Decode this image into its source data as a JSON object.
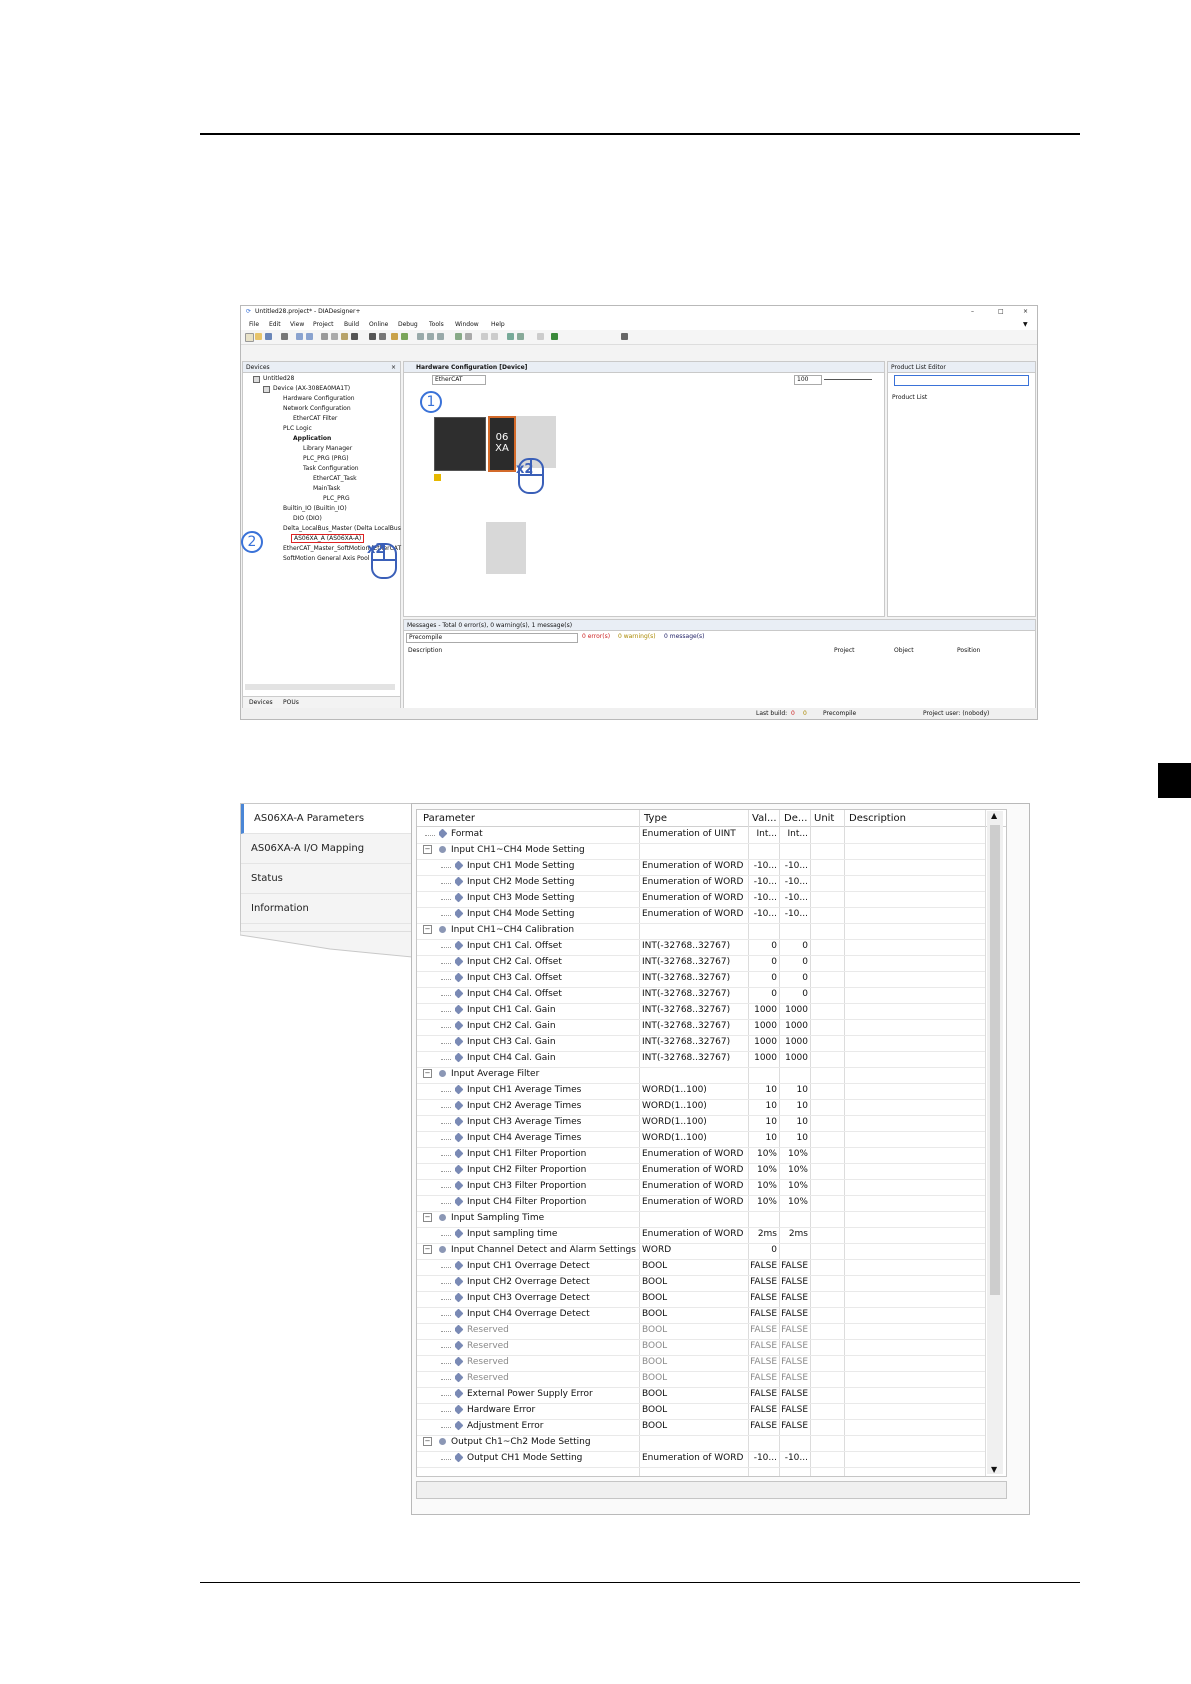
{
  "shot1": {
    "title": "Untitled28.project* - DIADesigner+",
    "window_controls": [
      "–",
      "□",
      "×"
    ],
    "menu": [
      "File",
      "Edit",
      "View",
      "Project",
      "Build",
      "Online",
      "Debug",
      "Tools",
      "Window",
      "Help"
    ],
    "devices_panel": {
      "title": "Devices",
      "tree": [
        "Untitled28",
        "Device (AX-308EA0MA1T)",
        "Hardware Configuration",
        "Network Configuration",
        "EtherCAT Filter",
        "PLC Logic",
        "Application",
        "Library Manager",
        "PLC_PRG (PRG)",
        "Task Configuration",
        "EtherCAT_Task",
        "MainTask",
        "PLC_PRG",
        "Builtin_IO (Builtin_IO)",
        "DIO (DIO)",
        "Delta_LocalBus_Master (Delta LocalBus Master)",
        "AS06XA_A (AS06XA-A)",
        "EtherCAT_Master_SoftMotion (EtherCAT Master S",
        "SoftMotion General Axis Pool"
      ],
      "bottom_tabs": [
        "Devices",
        "POUs"
      ]
    },
    "hw_tab": "Hardware Configuration [Device]",
    "network_select": "EtherCAT",
    "zoom": "100",
    "module_label_top": "06",
    "module_label_bottom": "XA",
    "product_panel": {
      "title": "Product List Editor",
      "tab": "Product List"
    },
    "messages": {
      "title": "Messages - Total 0 error(s), 0 warning(s), 1 message(s)",
      "filter": "Precompile",
      "errors": "0 error(s)",
      "warnings": "0 warning(s)",
      "messages": "0 message(s)",
      "cols": [
        "Description",
        "Project",
        "Object",
        "Position"
      ]
    },
    "status": {
      "last_build": "Last build:",
      "errs": "0",
      "warns": "0",
      "precompile": "Precompile",
      "user": "Project user: (nobody)"
    },
    "step1": "1",
    "step2": "2",
    "x2a": "x2",
    "x2b": "x2"
  },
  "shot2": {
    "nav": [
      "AS06XA-A Parameters",
      "AS06XA-A I/O Mapping",
      "Status",
      "Information"
    ],
    "headers": [
      "Parameter",
      "Type",
      "Val...",
      "De...",
      "Unit",
      "Description"
    ],
    "rows": [
      {
        "lvl": 1,
        "kind": "leaf",
        "name": "Format",
        "type": "Enumeration of UINT",
        "val": "Int...",
        "def": "Int..."
      },
      {
        "lvl": 0,
        "kind": "group",
        "name": "Input CH1~CH4 Mode Setting",
        "type": "",
        "val": "",
        "def": ""
      },
      {
        "lvl": 2,
        "kind": "leaf",
        "name": "Input CH1 Mode Setting",
        "type": "Enumeration of WORD",
        "val": "-10...",
        "def": "-10..."
      },
      {
        "lvl": 2,
        "kind": "leaf",
        "name": "Input CH2 Mode Setting",
        "type": "Enumeration of WORD",
        "val": "-10...",
        "def": "-10..."
      },
      {
        "lvl": 2,
        "kind": "leaf",
        "name": "Input CH3 Mode Setting",
        "type": "Enumeration of WORD",
        "val": "-10...",
        "def": "-10..."
      },
      {
        "lvl": 2,
        "kind": "leaf",
        "name": "Input CH4 Mode Setting",
        "type": "Enumeration of WORD",
        "val": "-10...",
        "def": "-10..."
      },
      {
        "lvl": 0,
        "kind": "group",
        "name": "Input CH1~CH4 Calibration",
        "type": "",
        "val": "",
        "def": ""
      },
      {
        "lvl": 2,
        "kind": "leaf",
        "name": "Input CH1 Cal. Offset",
        "type": "INT(-32768..32767)",
        "val": "0",
        "def": "0"
      },
      {
        "lvl": 2,
        "kind": "leaf",
        "name": "Input CH2 Cal. Offset",
        "type": "INT(-32768..32767)",
        "val": "0",
        "def": "0"
      },
      {
        "lvl": 2,
        "kind": "leaf",
        "name": "Input CH3 Cal. Offset",
        "type": "INT(-32768..32767)",
        "val": "0",
        "def": "0"
      },
      {
        "lvl": 2,
        "kind": "leaf",
        "name": "Input CH4 Cal. Offset",
        "type": "INT(-32768..32767)",
        "val": "0",
        "def": "0"
      },
      {
        "lvl": 2,
        "kind": "leaf",
        "name": "Input CH1 Cal. Gain",
        "type": "INT(-32768..32767)",
        "val": "1000",
        "def": "1000"
      },
      {
        "lvl": 2,
        "kind": "leaf",
        "name": "Input CH2 Cal. Gain",
        "type": "INT(-32768..32767)",
        "val": "1000",
        "def": "1000"
      },
      {
        "lvl": 2,
        "kind": "leaf",
        "name": "Input CH3 Cal. Gain",
        "type": "INT(-32768..32767)",
        "val": "1000",
        "def": "1000"
      },
      {
        "lvl": 2,
        "kind": "leaf",
        "name": "Input CH4 Cal. Gain",
        "type": "INT(-32768..32767)",
        "val": "1000",
        "def": "1000"
      },
      {
        "lvl": 0,
        "kind": "group",
        "name": "Input Average Filter",
        "type": "",
        "val": "",
        "def": ""
      },
      {
        "lvl": 2,
        "kind": "leaf",
        "name": "Input CH1 Average Times",
        "type": "WORD(1..100)",
        "val": "10",
        "def": "10"
      },
      {
        "lvl": 2,
        "kind": "leaf",
        "name": "Input CH2 Average Times",
        "type": "WORD(1..100)",
        "val": "10",
        "def": "10"
      },
      {
        "lvl": 2,
        "kind": "leaf",
        "name": "Input CH3 Average Times",
        "type": "WORD(1..100)",
        "val": "10",
        "def": "10"
      },
      {
        "lvl": 2,
        "kind": "leaf",
        "name": "Input CH4 Average Times",
        "type": "WORD(1..100)",
        "val": "10",
        "def": "10"
      },
      {
        "lvl": 2,
        "kind": "leaf",
        "name": "Input CH1 Filter Proportion",
        "type": "Enumeration of WORD",
        "val": "10%",
        "def": "10%"
      },
      {
        "lvl": 2,
        "kind": "leaf",
        "name": "Input CH2 Filter Proportion",
        "type": "Enumeration of WORD",
        "val": "10%",
        "def": "10%"
      },
      {
        "lvl": 2,
        "kind": "leaf",
        "name": "Input CH3 Filter Proportion",
        "type": "Enumeration of WORD",
        "val": "10%",
        "def": "10%"
      },
      {
        "lvl": 2,
        "kind": "leaf",
        "name": "Input CH4 Filter Proportion",
        "type": "Enumeration of WORD",
        "val": "10%",
        "def": "10%"
      },
      {
        "lvl": 0,
        "kind": "group",
        "name": "Input Sampling Time",
        "type": "",
        "val": "",
        "def": ""
      },
      {
        "lvl": 2,
        "kind": "leaf",
        "name": "Input sampling time",
        "type": "Enumeration of WORD",
        "val": "2ms",
        "def": "2ms"
      },
      {
        "lvl": 0,
        "kind": "group",
        "name": "Input Channel Detect and Alarm Settings",
        "type": "WORD",
        "val": "0",
        "def": ""
      },
      {
        "lvl": 2,
        "kind": "leaf",
        "name": "Input CH1 Overrage Detect",
        "type": "BOOL",
        "val": "FALSE",
        "def": "FALSE"
      },
      {
        "lvl": 2,
        "kind": "leaf",
        "name": "Input CH2 Overrage Detect",
        "type": "BOOL",
        "val": "FALSE",
        "def": "FALSE"
      },
      {
        "lvl": 2,
        "kind": "leaf",
        "name": "Input CH3 Overrage Detect",
        "type": "BOOL",
        "val": "FALSE",
        "def": "FALSE"
      },
      {
        "lvl": 2,
        "kind": "leaf",
        "name": "Input CH4 Overrage Detect",
        "type": "BOOL",
        "val": "FALSE",
        "def": "FALSE"
      },
      {
        "lvl": 2,
        "kind": "leaf",
        "gray": true,
        "name": "Reserved",
        "type": "BOOL",
        "val": "FALSE",
        "def": "FALSE"
      },
      {
        "lvl": 2,
        "kind": "leaf",
        "gray": true,
        "name": "Reserved",
        "type": "BOOL",
        "val": "FALSE",
        "def": "FALSE"
      },
      {
        "lvl": 2,
        "kind": "leaf",
        "gray": true,
        "name": "Reserved",
        "type": "BOOL",
        "val": "FALSE",
        "def": "FALSE"
      },
      {
        "lvl": 2,
        "kind": "leaf",
        "gray": true,
        "name": "Reserved",
        "type": "BOOL",
        "val": "FALSE",
        "def": "FALSE"
      },
      {
        "lvl": 2,
        "kind": "leaf",
        "name": "External Power Supply Error",
        "type": "BOOL",
        "val": "FALSE",
        "def": "FALSE"
      },
      {
        "lvl": 2,
        "kind": "leaf",
        "name": "Hardware Error",
        "type": "BOOL",
        "val": "FALSE",
        "def": "FALSE"
      },
      {
        "lvl": 2,
        "kind": "leaf",
        "name": "Adjustment Error",
        "type": "BOOL",
        "val": "FALSE",
        "def": "FALSE"
      },
      {
        "lvl": 0,
        "kind": "group",
        "name": "Output Ch1~Ch2 Mode Setting",
        "type": "",
        "val": "",
        "def": ""
      },
      {
        "lvl": 2,
        "kind": "leaf",
        "name": "Output CH1 Mode Setting",
        "type": "Enumeration of WORD",
        "val": "-10...",
        "def": "-10..."
      }
    ]
  }
}
